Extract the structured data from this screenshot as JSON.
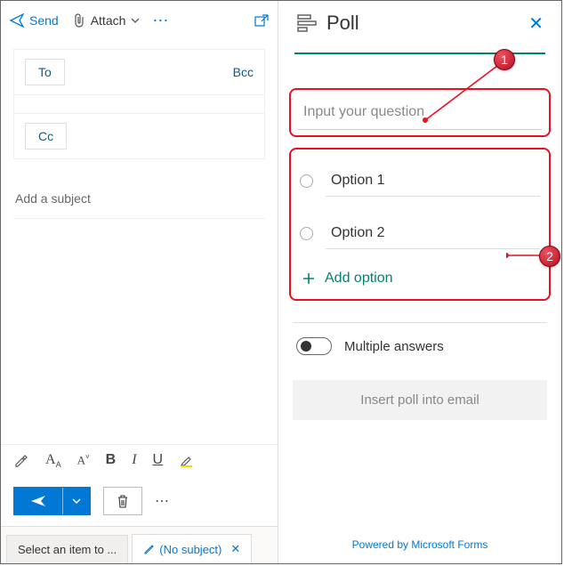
{
  "compose": {
    "send": "Send",
    "attach": "Attach",
    "to": "To",
    "cc": "Cc",
    "bcc": "Bcc",
    "subject_placeholder": "Add a subject"
  },
  "tabs": {
    "tab1": "Select an item to ...",
    "tab2": "(No subject)"
  },
  "poll": {
    "title": "Poll",
    "question_placeholder": "Input your question",
    "option1": "Option 1",
    "option2": "Option 2",
    "add_option": "Add option",
    "multiple_answers": "Multiple answers",
    "insert": "Insert poll into email",
    "powered": "Powered by Microsoft Forms"
  },
  "callouts": {
    "one": "1",
    "two": "2"
  }
}
